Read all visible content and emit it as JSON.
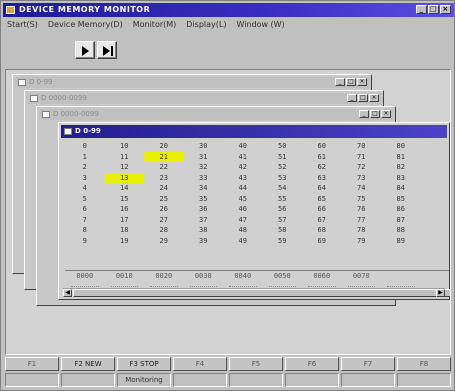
{
  "window": {
    "title": "DEVICE MEMORY MONITOR",
    "buttons": [
      "_",
      "□",
      "×"
    ]
  },
  "menu": [
    "Start(S)",
    "Device Memory(D)",
    "Monitor(M)",
    "Display(L)",
    "Window (W)"
  ],
  "toolbar": {
    "run_icon": "play-icon",
    "step_icon": "step-play-icon"
  },
  "child_windows": [
    {
      "title": "D 0-99"
    },
    {
      "title": "D 0000-0099"
    },
    {
      "title": "D 0000-0099"
    }
  ],
  "active_window": {
    "title": "D 0-99",
    "rows": [
      [
        "0",
        "10",
        "20",
        "30",
        "40",
        "50",
        "60",
        "70",
        "80"
      ],
      [
        "1",
        "11",
        "21",
        "31",
        "41",
        "51",
        "61",
        "71",
        "81"
      ],
      [
        "2",
        "12",
        "22",
        "32",
        "42",
        "52",
        "62",
        "72",
        "82"
      ],
      [
        "3",
        "13",
        "23",
        "33",
        "43",
        "53",
        "63",
        "73",
        "83"
      ],
      [
        "4",
        "14",
        "24",
        "34",
        "44",
        "54",
        "64",
        "74",
        "84"
      ],
      [
        "5",
        "15",
        "25",
        "35",
        "45",
        "55",
        "65",
        "75",
        "85"
      ],
      [
        "6",
        "16",
        "26",
        "36",
        "46",
        "56",
        "66",
        "76",
        "86"
      ],
      [
        "7",
        "17",
        "27",
        "37",
        "47",
        "57",
        "67",
        "77",
        "87"
      ],
      [
        "8",
        "18",
        "28",
        "38",
        "48",
        "58",
        "68",
        "78",
        "88"
      ],
      [
        "9",
        "19",
        "29",
        "39",
        "49",
        "59",
        "69",
        "79",
        "89"
      ]
    ],
    "highlighted_cells": [
      [
        1,
        2
      ],
      [
        3,
        1
      ]
    ],
    "highlight_color": "#e8f000",
    "footer": [
      "0000",
      "0010",
      "0020",
      "0030",
      "0040",
      "0050",
      "0060",
      "0070",
      ""
    ]
  },
  "function_keys": [
    "F1",
    "F2 NEW",
    "F3 STOP",
    "F4",
    "F5",
    "F6",
    "F7",
    "F8"
  ],
  "status": [
    "",
    "",
    "Monitoring",
    "",
    "",
    "",
    "",
    ""
  ],
  "colors": {
    "title_bar": "#1e1a9a",
    "active_child_title": "#241e8e",
    "background": "#c0c0c0"
  }
}
